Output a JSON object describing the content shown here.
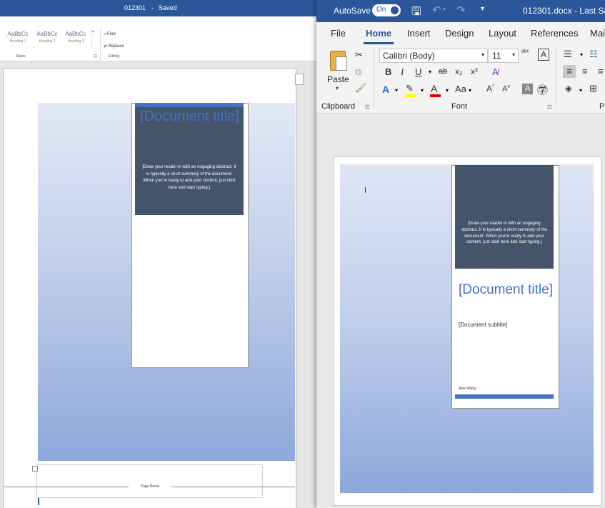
{
  "background_window": {
    "title": "012301",
    "title_sep": "-",
    "status": "Saved",
    "styles": [
      {
        "sample": "AaBbCc",
        "name": "Heading 1"
      },
      {
        "sample": "AaBbCc",
        "name": "Heading 2"
      },
      {
        "sample": "AaBbCc",
        "name": "Heading 3"
      }
    ],
    "find_label": "Find",
    "replace_label": "Replace",
    "group_styles": "Styles",
    "group_editing": "Editing",
    "doc_title": "[Document title]",
    "abstract": "[Draw your reader in with an engaging abstract. It is typically a short summary of the document. When you're ready to add your content, just click here and start typing.]",
    "page_break_label": "Page Break"
  },
  "window": {
    "autosave_label": "AutoSave",
    "autosave_state": "On",
    "file_name": "012301.docx",
    "title_sep": "-",
    "status": "Last Sa"
  },
  "tabs": [
    {
      "label": "File"
    },
    {
      "label": "Home"
    },
    {
      "label": "Insert"
    },
    {
      "label": "Design"
    },
    {
      "label": "Layout"
    },
    {
      "label": "References"
    },
    {
      "label": "Mai"
    }
  ],
  "ribbon": {
    "paste_label": "Paste",
    "font_name": "Calibri (Body)",
    "font_size": "11",
    "groups": {
      "clipboard": "Clipboard",
      "font": "Font",
      "paragraph": "Pa"
    },
    "font_buttons": [
      "B",
      "I",
      "U",
      "ab",
      "x₂",
      "x²"
    ],
    "size_buttons": [
      "A",
      "A"
    ]
  },
  "document": {
    "abstract": "[Draw your reader in with an engaging abstract. It is typically a short summary of the document. When you're ready to add your content, just click here and start typing.]",
    "title": "[Document title]",
    "subtitle": "[Document subtitle]",
    "author": "Alex Wang"
  },
  "colors": {
    "title_bar": "#2b579a",
    "accent": "#4472c4",
    "cover_card": "#44546a"
  }
}
